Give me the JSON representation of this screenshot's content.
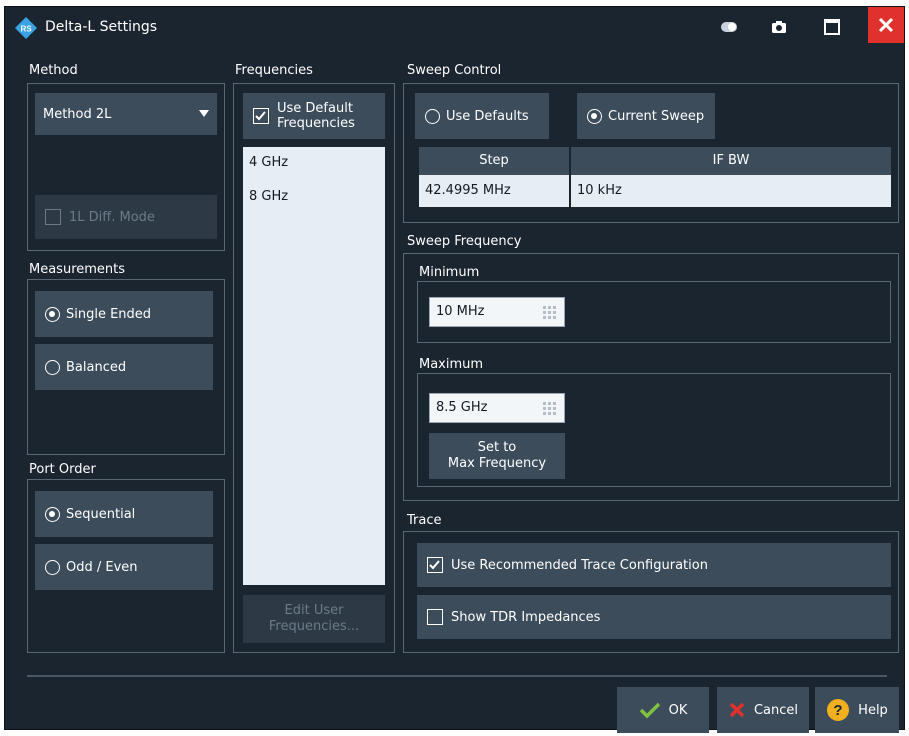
{
  "window": {
    "title": "Delta-L Settings"
  },
  "method": {
    "label": "Method",
    "dropdown_value": "Method 2L",
    "diff_mode_label": "1L Diff. Mode"
  },
  "measurements": {
    "label": "Measurements",
    "options": [
      "Single Ended",
      "Balanced"
    ],
    "selected": "Single Ended"
  },
  "port_order": {
    "label": "Port Order",
    "options": [
      "Sequential",
      "Odd / Even"
    ],
    "selected": "Sequential"
  },
  "frequencies": {
    "label": "Frequencies",
    "use_default_line1": "Use Default",
    "use_default_line2": "Frequencies",
    "use_default_checked": true,
    "list": [
      "4 GHz",
      "8 GHz"
    ],
    "edit_line1": "Edit User",
    "edit_line2": "Frequencies..."
  },
  "sweep_control": {
    "label": "Sweep Control",
    "use_defaults": "Use Defaults",
    "current_sweep": "Current Sweep",
    "selected": "Current Sweep",
    "table": {
      "headers": [
        "Step",
        "IF BW"
      ],
      "row": [
        "42.4995 MHz",
        "10 kHz"
      ]
    }
  },
  "sweep_frequency": {
    "label": "Sweep Frequency",
    "minimum_label": "Minimum",
    "minimum_value": "10 MHz",
    "maximum_label": "Maximum",
    "maximum_value": "8.5 GHz",
    "set_max_line1": "Set to",
    "set_max_line2": "Max Frequency"
  },
  "trace": {
    "label": "Trace",
    "recommended": "Use Recommended Trace Configuration",
    "recommended_checked": true,
    "show_tdr": "Show TDR Impedances",
    "show_tdr_checked": false
  },
  "footer": {
    "ok": "OK",
    "cancel": "Cancel",
    "help": "Help"
  },
  "colors": {
    "background": "#1b2530",
    "button": "#3c4c5b",
    "close": "#e0312d",
    "ok_check": "#7fc241",
    "cancel_x": "#e0312d",
    "help": "#f2b01e"
  }
}
